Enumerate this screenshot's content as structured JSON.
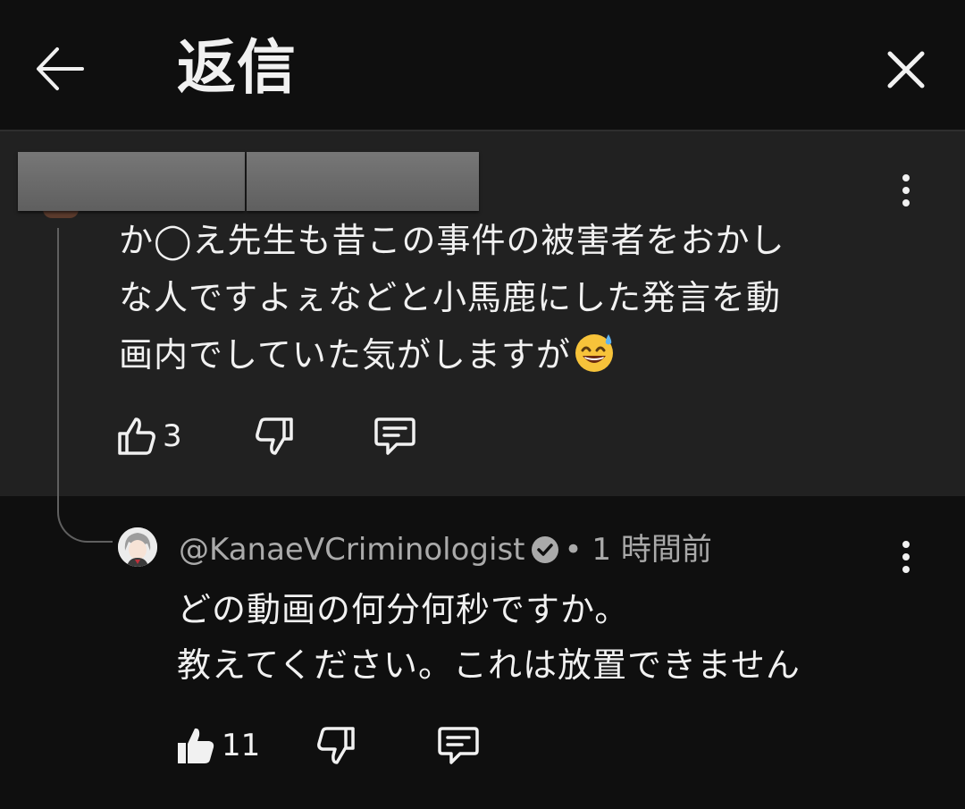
{
  "header": {
    "title": "返信"
  },
  "parent_comment": {
    "text_lines": [
      "か◯え先生も昔この事件の被害者をおかし",
      "な人ですよぇなどと小馬鹿にした発言を動",
      "画内でしていた気がしますが"
    ],
    "emoji": "sweat-smile-emoji",
    "likes": "3"
  },
  "reply": {
    "author": "@KanaeVCriminologist",
    "separator": "•",
    "time": "1 時間前",
    "text_lines": [
      "どの動画の何分何秒ですか。",
      "教えてください。これは放置できません"
    ],
    "likes": "11"
  },
  "colors": {
    "background": "#0f0f0f",
    "parent_background": "#212121",
    "text": "#f1f1f1",
    "meta": "#aaaaaa"
  }
}
